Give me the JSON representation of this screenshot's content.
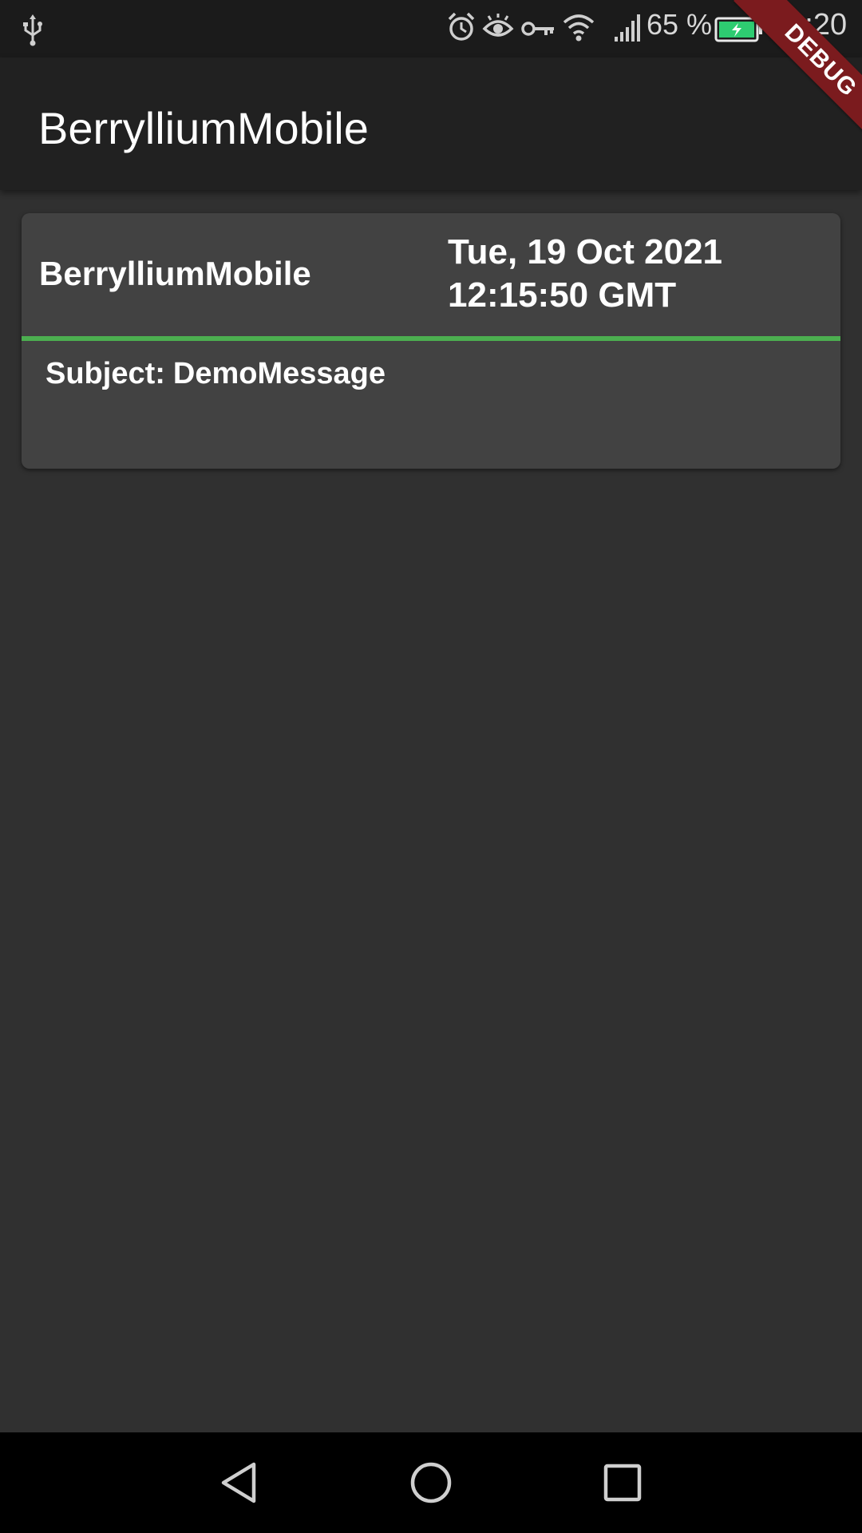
{
  "status_bar": {
    "battery_percent": "65 %",
    "time": "12:20",
    "icons": [
      "usb-icon",
      "alarm-icon",
      "eye-icon",
      "vpn-key-icon",
      "wifi-icon",
      "signal-icon",
      "battery-charging-icon"
    ]
  },
  "debug_banner": "DEBUG",
  "app_bar": {
    "title": "BerrylliumMobile"
  },
  "messages": [
    {
      "sender": "BerrylliumMobile",
      "date_line1": "Tue, 19 Oct 2021",
      "date_line2": "12:15:50 GMT",
      "subject_label": "Subject:",
      "subject": "DemoMessage"
    }
  ],
  "colors": {
    "background": "#303030",
    "app_bar": "#212121",
    "card": "#424242",
    "accent_divider": "#4caf50",
    "debug_ribbon": "#7b1b1e"
  },
  "nav_bar": {
    "buttons": [
      "back-icon",
      "home-icon",
      "recents-icon"
    ]
  }
}
